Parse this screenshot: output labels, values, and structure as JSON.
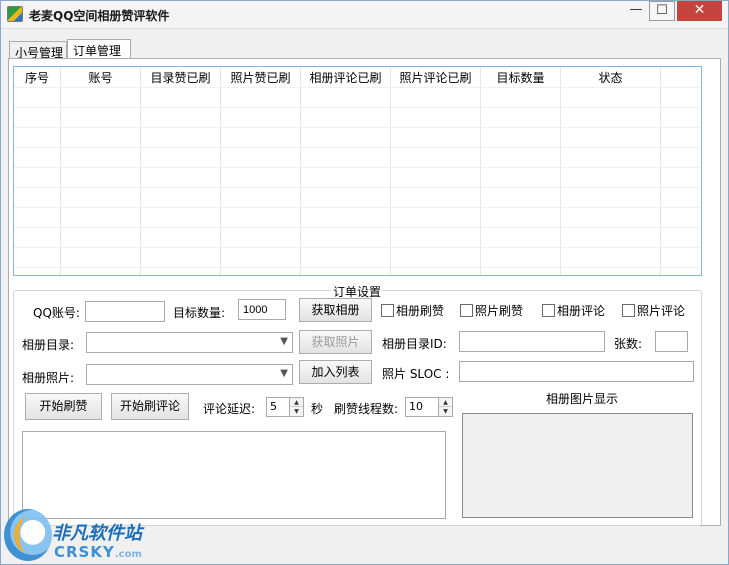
{
  "window": {
    "title": "老麦QQ空间相册赞评软件",
    "minimize_glyph": "—",
    "maximize_glyph": "☐",
    "close_glyph": "✕"
  },
  "tabs": [
    {
      "label": "小号管理"
    },
    {
      "label": "订单管理"
    }
  ],
  "table": {
    "columns": [
      "序号",
      "账号",
      "目录赞已刷",
      "照片赞已刷",
      "相册评论已刷",
      "照片评论已刷",
      "目标数量",
      "状态"
    ]
  },
  "settings": {
    "group_title": "订单设置",
    "qq_label": "QQ账号:",
    "qq_value": "",
    "target_count_label": "目标数量:",
    "target_count_value": "1000",
    "get_album_button": "获取相册",
    "album_like_check": "相册刷赞",
    "photo_like_check": "照片刷赞",
    "album_comment_check": "相册评论",
    "photo_comment_check": "照片评论",
    "album_dir_label": "相册目录:",
    "album_dir_value": "",
    "get_photo_button": "获取照片",
    "album_dir_id_label": "相册目录ID:",
    "album_dir_id_value": "",
    "sheet_count_label": "张数:",
    "sheet_count_value": "",
    "album_photo_label": "相册照片:",
    "album_photo_value": "",
    "add_list_button": "加入列表",
    "photo_sloc_label": "照片 SLOC :",
    "photo_sloc_value": "",
    "start_like_button": "开始刷赞",
    "start_comment_button": "开始刷评论",
    "comment_delay_label": "评论延迟:",
    "comment_delay_value": "5",
    "seconds_label": "秒",
    "like_threads_label": "刷赞线程数:",
    "like_threads_value": "10",
    "photo_display_label": "相册图片显示"
  },
  "watermark": {
    "cn": "非凡软件站",
    "en": "CRSKY",
    "domain": ".com"
  },
  "colors": {
    "close_button": "#c7443e",
    "grid_border": "#82b8e8",
    "watermark_blue": "#1d6fb8"
  }
}
